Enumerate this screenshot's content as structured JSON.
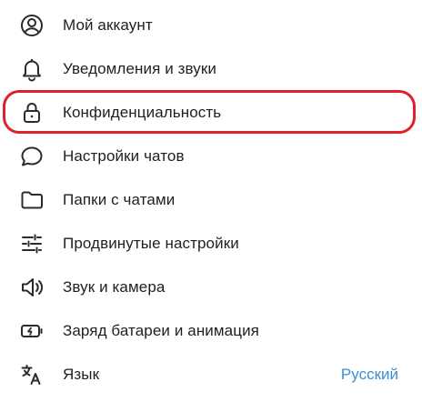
{
  "menu": {
    "items": [
      {
        "label": "Мой аккаунт",
        "icon": "account-circle-icon"
      },
      {
        "label": "Уведомления и звуки",
        "icon": "bell-icon"
      },
      {
        "label": "Конфиденциальность",
        "icon": "lock-icon"
      },
      {
        "label": "Настройки чатов",
        "icon": "chat-bubble-icon"
      },
      {
        "label": "Папки с чатами",
        "icon": "folder-icon"
      },
      {
        "label": "Продвинутые настройки",
        "icon": "sliders-icon"
      },
      {
        "label": "Звук и камера",
        "icon": "speaker-icon"
      },
      {
        "label": "Заряд батареи и анимация",
        "icon": "battery-bolt-icon"
      },
      {
        "label": "Язык",
        "icon": "translate-icon",
        "value": "Русский"
      }
    ]
  },
  "colors": {
    "text": "#1f1f1f",
    "icon": "#2b2b2b",
    "accent": "#3a8fd6",
    "highlight": "#e0202a"
  }
}
